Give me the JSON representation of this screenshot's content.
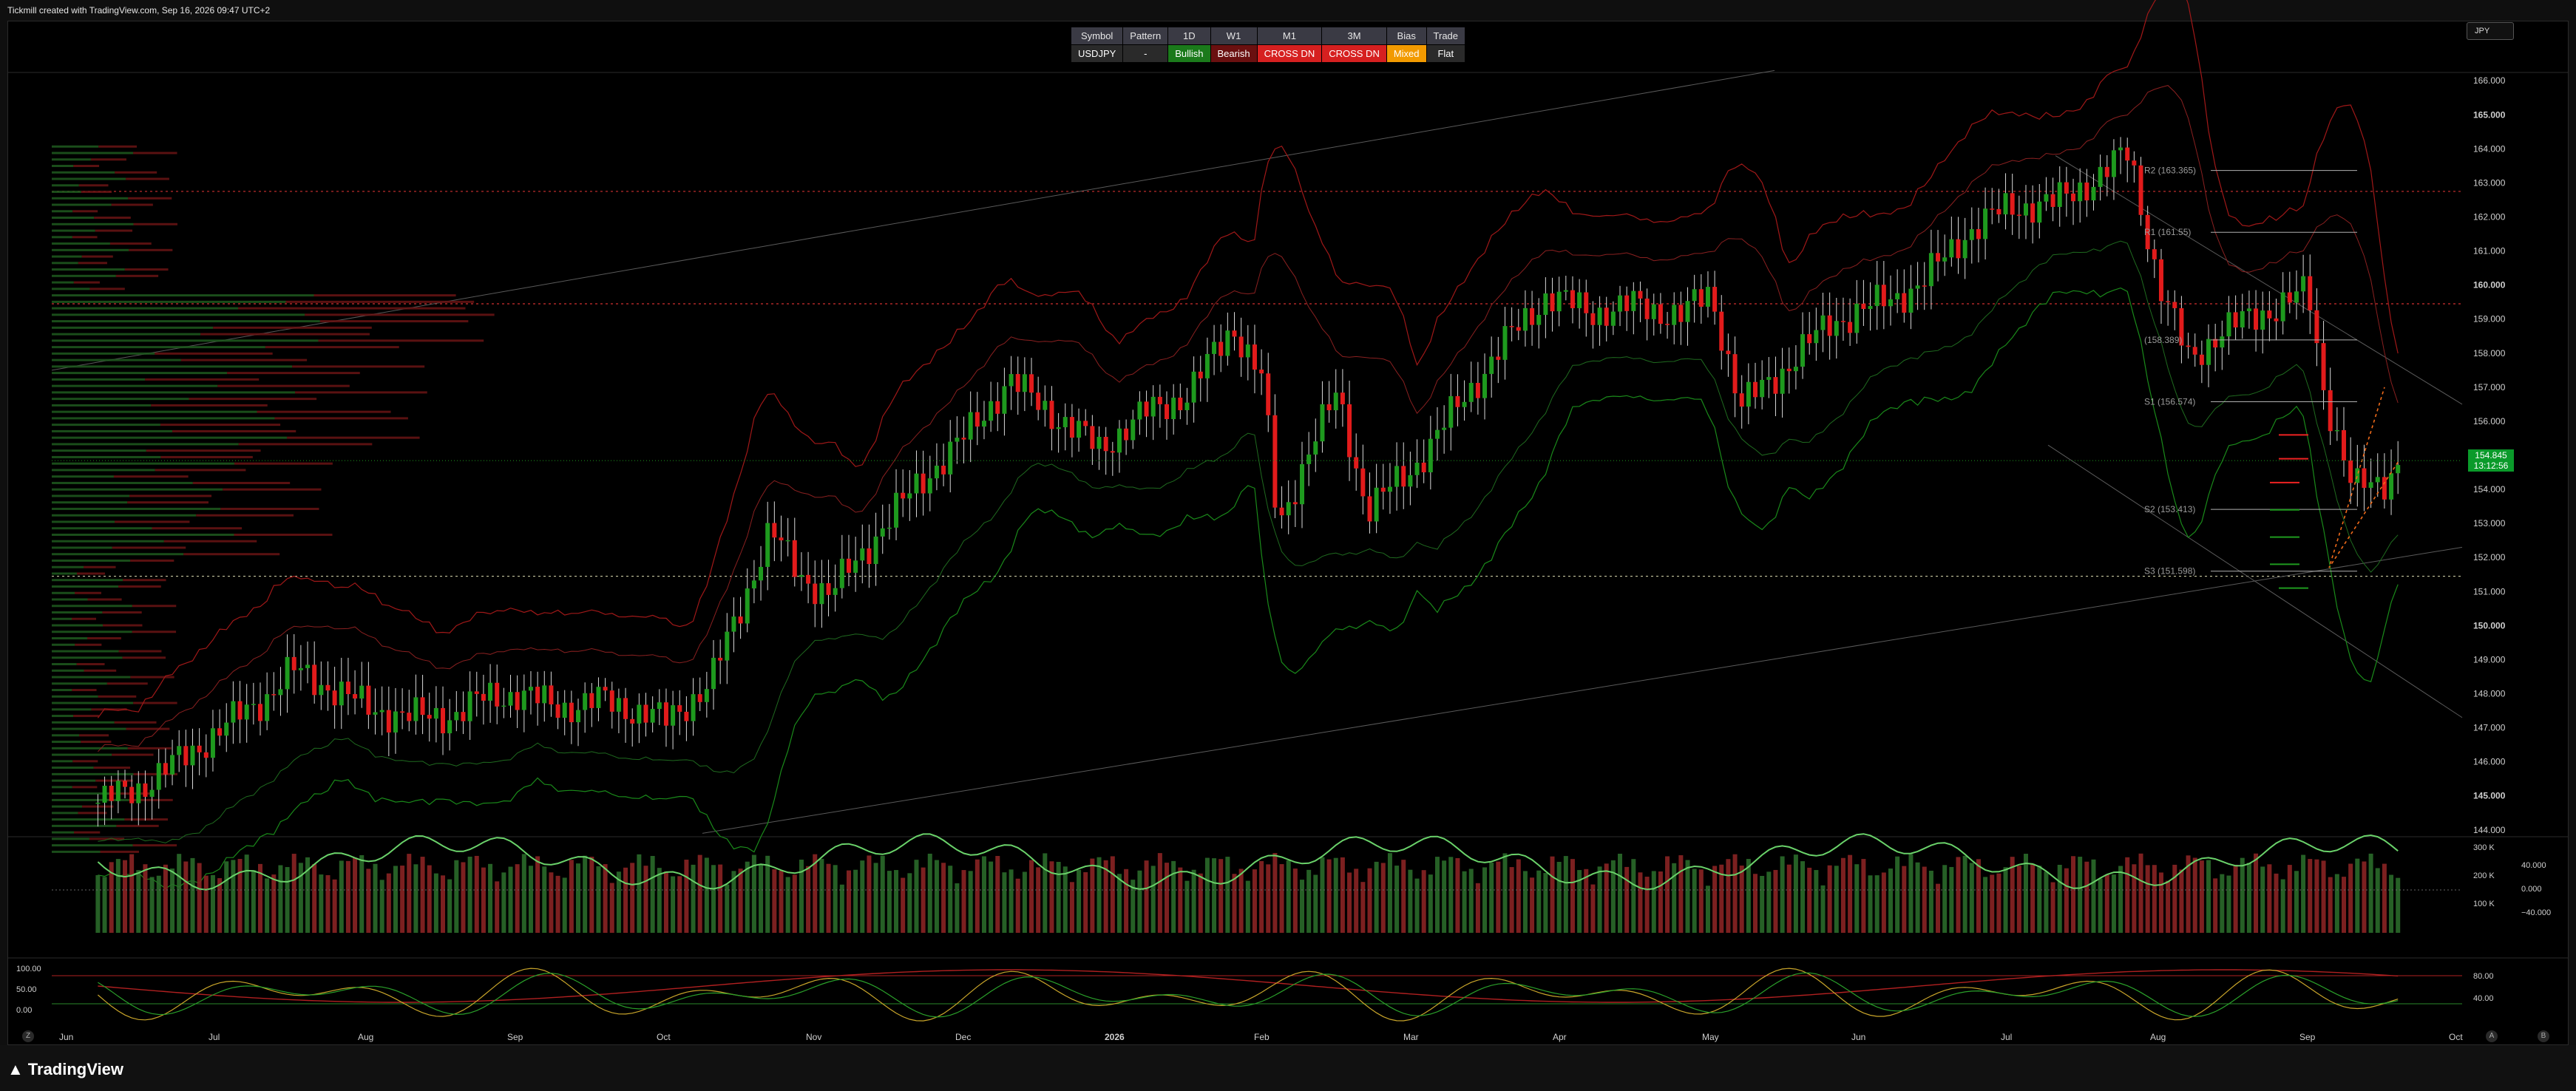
{
  "header": {
    "caption": "Tickmill created with TradingView.com, Sep 16, 2026 09:47 UTC+2"
  },
  "footer": {
    "brand": "TradingView"
  },
  "currency_button": "JPY",
  "price_tag": {
    "price": "154.845",
    "countdown": "13:12:56"
  },
  "corner_buttons": [
    "Z",
    "A",
    "B"
  ],
  "signal_table": {
    "headers": [
      "Symbol",
      "Pattern",
      "1D",
      "W1",
      "M1",
      "3M",
      "Bias",
      "Trade"
    ],
    "row": [
      "USDJPY",
      "-",
      "Bullish",
      "Bearish",
      "CROSS DN",
      "CROSS DN",
      "Mixed",
      "Flat"
    ]
  },
  "colors": {
    "bull": "#1e9a1e",
    "bear": "#e21b1b",
    "grid": "#1a1a1a",
    "axis_text": "#cfcfcf"
  },
  "chart_data": [
    {
      "type": "candlestick",
      "symbol": "USDJPY",
      "x_ticks": [
        "Jun",
        "Jul",
        "Aug",
        "Sep",
        "Oct",
        "Nov",
        "Dec",
        "2026",
        "Feb",
        "Mar",
        "Apr",
        "May",
        "Jun",
        "Jul",
        "Aug",
        "Sep",
        "Oct"
      ],
      "y_ticks": [
        "166.000",
        "165.000",
        "164.000",
        "163.000",
        "162.000",
        "161.000",
        "160.000",
        "159.000",
        "158.000",
        "157.000",
        "156.000",
        "155.000",
        "154.000",
        "153.000",
        "152.000",
        "151.000",
        "150.000",
        "149.000",
        "148.000",
        "147.000",
        "146.000",
        "145.000",
        "144.000"
      ],
      "ylim": [
        143.8,
        166.2
      ],
      "last_price": 154.845,
      "pivot_levels": [
        {
          "label": "R2 (163.365)",
          "value": 163.365
        },
        {
          "label": "R1 (161.55)",
          "value": 161.55
        },
        {
          "label": "(158.389)",
          "value": 158.389
        },
        {
          "label": "S1 (156.574)",
          "value": 156.574
        },
        {
          "label": "S2 (153.413)",
          "value": 153.413
        },
        {
          "label": "S3 (151.598)",
          "value": 151.598
        }
      ],
      "horizontal_levels": [
        162.75,
        159.45,
        151.45
      ],
      "closes": [
        {
          "m": 0.2,
          "v": 144.8
        },
        {
          "m": 0.5,
          "v": 145.3
        },
        {
          "m": 0.8,
          "v": 146.2
        },
        {
          "m": 1.0,
          "v": 146.9
        },
        {
          "m": 1.3,
          "v": 147.8
        },
        {
          "m": 1.5,
          "v": 148.7
        },
        {
          "m": 1.8,
          "v": 148.1
        },
        {
          "m": 2.0,
          "v": 147.6
        },
        {
          "m": 2.3,
          "v": 147.3
        },
        {
          "m": 2.6,
          "v": 147.4
        },
        {
          "m": 2.8,
          "v": 147.9
        },
        {
          "m": 3.0,
          "v": 148.0
        },
        {
          "m": 3.3,
          "v": 147.6
        },
        {
          "m": 3.6,
          "v": 147.8
        },
        {
          "m": 3.8,
          "v": 147.5
        },
        {
          "m": 4.0,
          "v": 147.2
        },
        {
          "m": 4.3,
          "v": 148.3
        },
        {
          "m": 4.5,
          "v": 150.5
        },
        {
          "m": 4.7,
          "v": 152.8
        },
        {
          "m": 4.9,
          "v": 151.5
        },
        {
          "m": 5.1,
          "v": 150.9
        },
        {
          "m": 5.4,
          "v": 152.6
        },
        {
          "m": 5.7,
          "v": 154.2
        },
        {
          "m": 6.0,
          "v": 155.5
        },
        {
          "m": 6.3,
          "v": 157.2
        },
        {
          "m": 6.6,
          "v": 156.2
        },
        {
          "m": 6.9,
          "v": 155.2
        },
        {
          "m": 7.2,
          "v": 156.2
        },
        {
          "m": 7.5,
          "v": 156.8
        },
        {
          "m": 7.8,
          "v": 158.8
        },
        {
          "m": 8.0,
          "v": 157.2
        },
        {
          "m": 8.1,
          "v": 152.8
        },
        {
          "m": 8.3,
          "v": 155.1
        },
        {
          "m": 8.5,
          "v": 156.8
        },
        {
          "m": 8.7,
          "v": 153.4
        },
        {
          "m": 9.0,
          "v": 154.6
        },
        {
          "m": 9.3,
          "v": 156.4
        },
        {
          "m": 9.6,
          "v": 158.2
        },
        {
          "m": 9.9,
          "v": 159.7
        },
        {
          "m": 10.2,
          "v": 159.2
        },
        {
          "m": 10.5,
          "v": 159.4
        },
        {
          "m": 10.8,
          "v": 159.1
        },
        {
          "m": 11.0,
          "v": 159.8
        },
        {
          "m": 11.2,
          "v": 156.4
        },
        {
          "m": 11.5,
          "v": 157.6
        },
        {
          "m": 11.8,
          "v": 158.9
        },
        {
          "m": 12.1,
          "v": 159.4
        },
        {
          "m": 12.4,
          "v": 160.0
        },
        {
          "m": 12.7,
          "v": 161.5
        },
        {
          "m": 13.0,
          "v": 162.3
        },
        {
          "m": 13.3,
          "v": 162.4
        },
        {
          "m": 13.6,
          "v": 163.2
        },
        {
          "m": 13.8,
          "v": 163.9
        },
        {
          "m": 14.0,
          "v": 160.0
        },
        {
          "m": 14.2,
          "v": 157.8
        },
        {
          "m": 14.4,
          "v": 158.6
        },
        {
          "m": 14.7,
          "v": 159.2
        },
        {
          "m": 15.0,
          "v": 159.8
        },
        {
          "m": 15.1,
          "v": 157.0
        },
        {
          "m": 15.3,
          "v": 154.0
        },
        {
          "m": 15.5,
          "v": 154.2
        },
        {
          "m": 15.6,
          "v": 154.8
        }
      ]
    },
    {
      "type": "bar",
      "panel": "volume",
      "y_ticks": [
        "300 K",
        "200 K",
        "100 K"
      ],
      "y2_ticks": [
        "40.000",
        "0.000",
        "−40.000"
      ]
    },
    {
      "type": "line",
      "panel": "oscillator",
      "y_ticks": [
        "100.00",
        "50.00",
        "0.00"
      ],
      "y2_ticks": [
        "80.00",
        "40.00"
      ]
    }
  ]
}
